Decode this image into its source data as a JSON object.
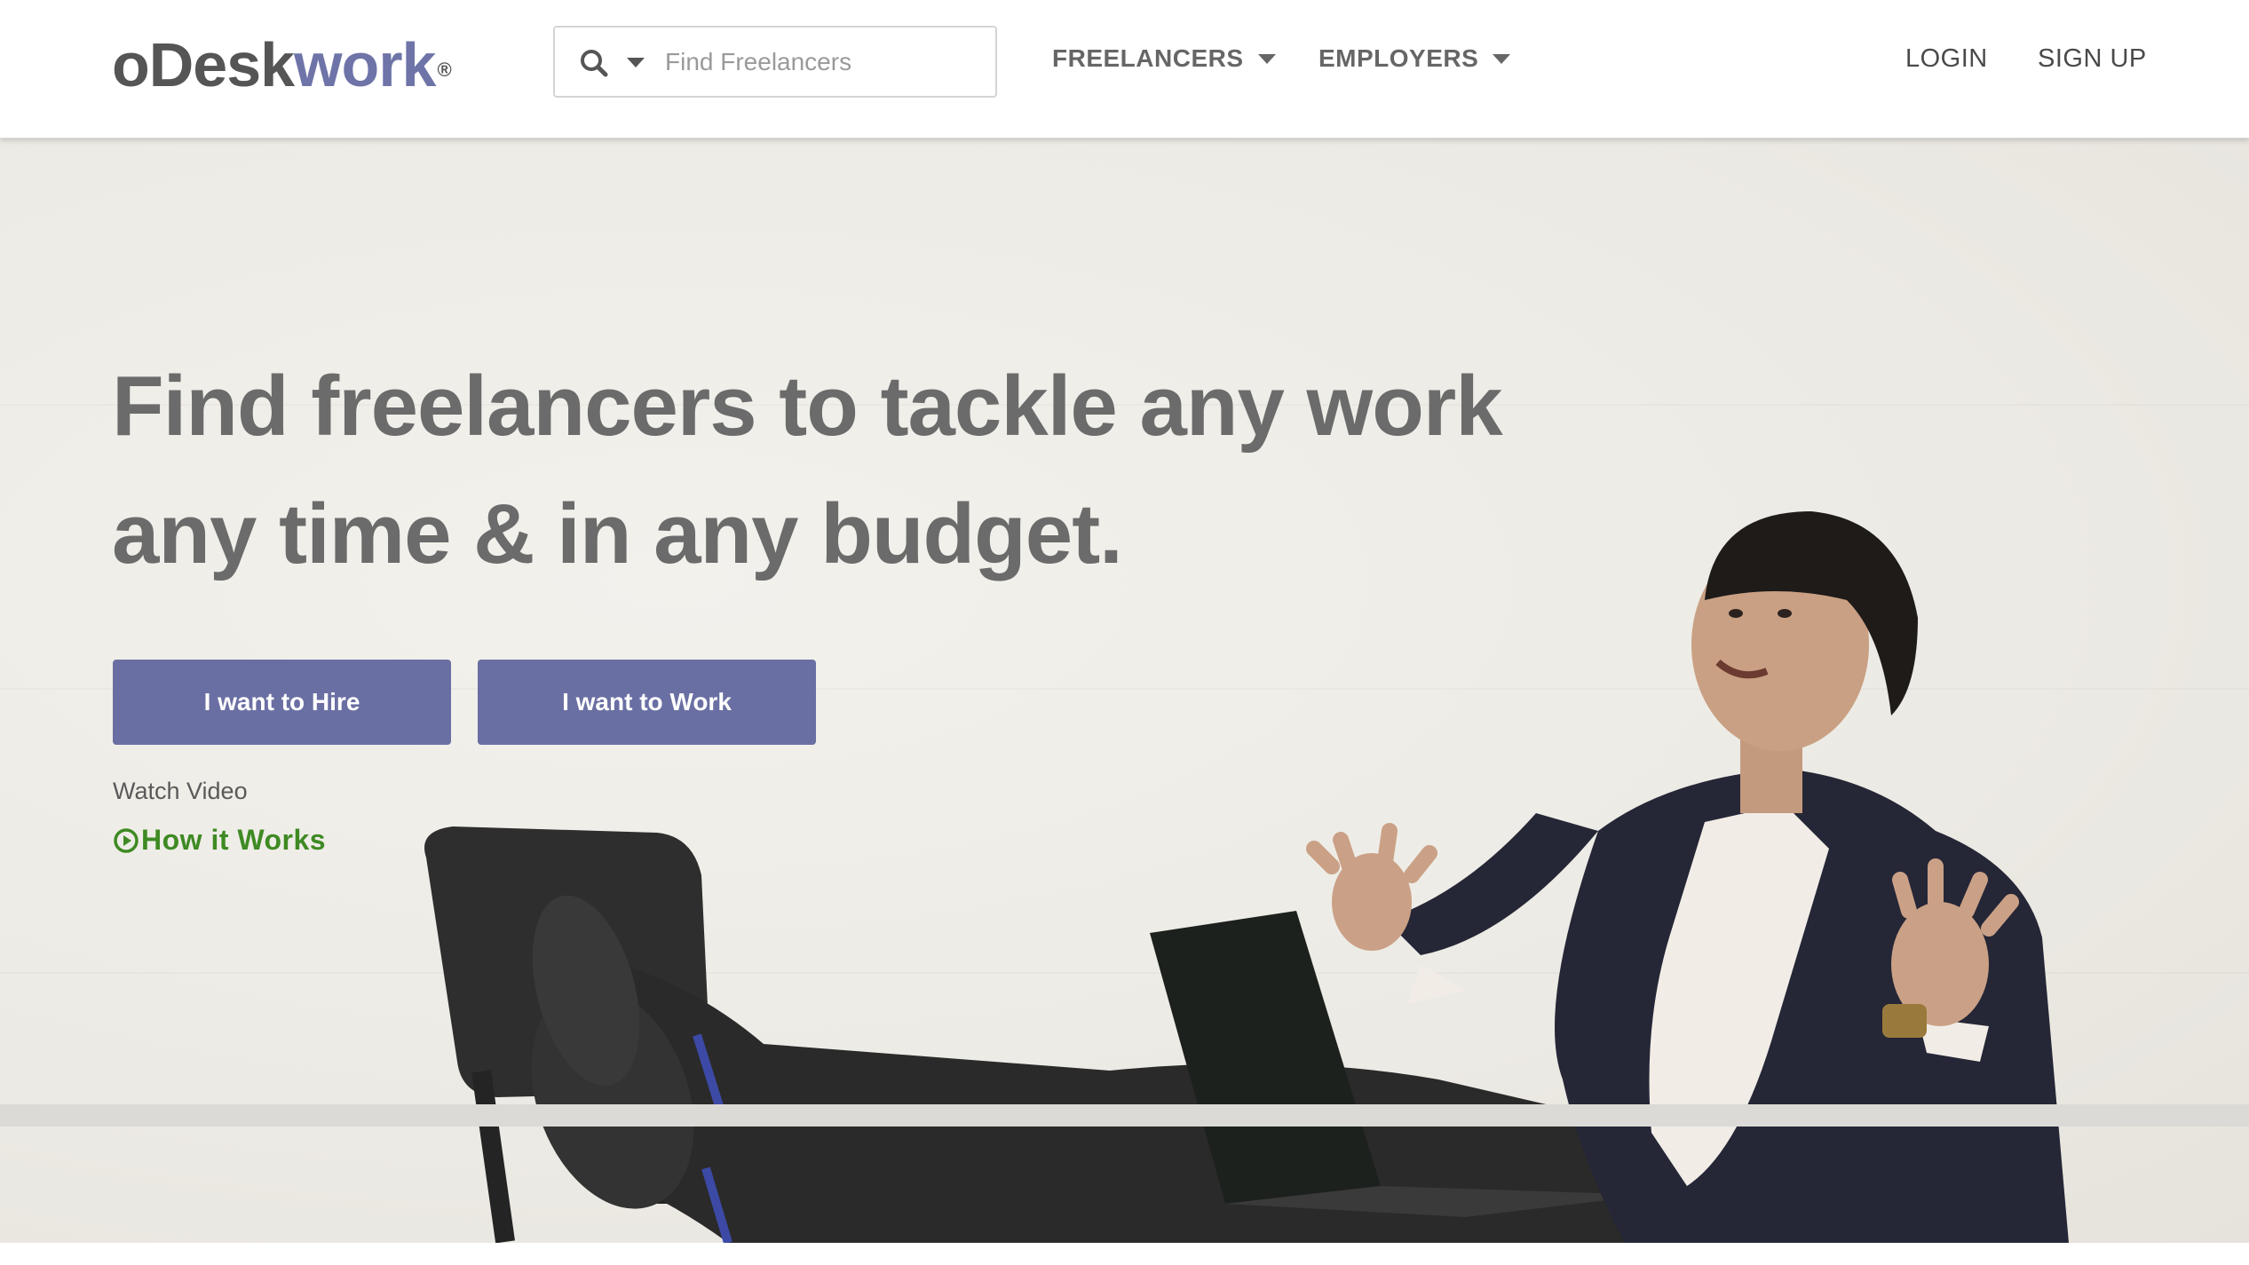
{
  "header": {
    "logo_part1": "oDesk",
    "logo_part2": "work",
    "logo_mark": "®",
    "search": {
      "placeholder": "Find Freelancers",
      "value": "",
      "icon": "search-icon",
      "dropdown_icon": "caret-down-icon"
    },
    "menus": {
      "freelancers": "FREELANCERS",
      "employers": "EMPLOYERS"
    },
    "login": "LOGIN",
    "signup": "SIGN UP"
  },
  "hero": {
    "headline": "Find freelancers to tackle any work any time & in any budget.",
    "hire_button": "I want to Hire",
    "work_button": "I want to Work",
    "watch_label": "Watch Video",
    "how_link": "How it Works",
    "how_icon": "play-circle-icon",
    "image_subject": "man in suit reclining with laptop, feet up on chair"
  },
  "colors": {
    "brand_purple": "#6a6fa3",
    "logo_purple": "#6e74a8",
    "link_green": "#3e8a23",
    "text_gray": "#6b6b6b",
    "hero_bg": "#eceae4"
  }
}
